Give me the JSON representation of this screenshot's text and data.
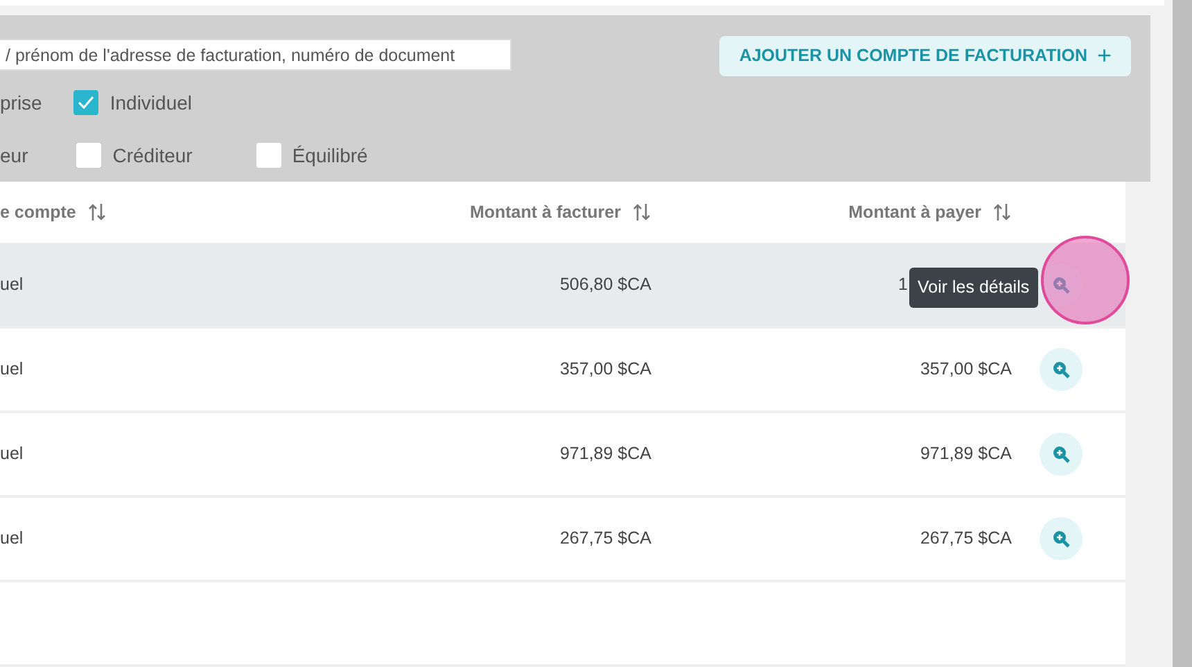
{
  "search": {
    "placeholder": "/ prénom de l'adresse de facturation, numéro de document"
  },
  "add_button": {
    "label": "AJOUTER UN COMPTE DE FACTURATION",
    "icon": "+"
  },
  "filters": [
    [
      {
        "kind": "label",
        "label": "prise"
      },
      {
        "kind": "checkbox",
        "label": "Individuel",
        "checked": true
      }
    ],
    [
      {
        "kind": "label",
        "label": "eur"
      },
      {
        "kind": "checkbox",
        "label": "Créditeur",
        "checked": false
      },
      {
        "kind": "checkbox",
        "label": "Équilibré",
        "checked": false
      }
    ]
  ],
  "table": {
    "columns": [
      "e compte",
      "Montant à facturer",
      "Montant à payer"
    ],
    "rows": [
      {
        "account_type": "uel",
        "to_invoice": "506,80 $CA",
        "to_pay": "1",
        "hovered": true
      },
      {
        "account_type": "uel",
        "to_invoice": "357,00 $CA",
        "to_pay": "357,00 $CA",
        "hovered": false
      },
      {
        "account_type": "uel",
        "to_invoice": "971,89 $CA",
        "to_pay": "971,89 $CA",
        "hovered": false
      },
      {
        "account_type": "uel",
        "to_invoice": "267,75 $CA",
        "to_pay": "267,75 $CA",
        "hovered": false
      }
    ]
  },
  "tooltip": "Voir les détails"
}
